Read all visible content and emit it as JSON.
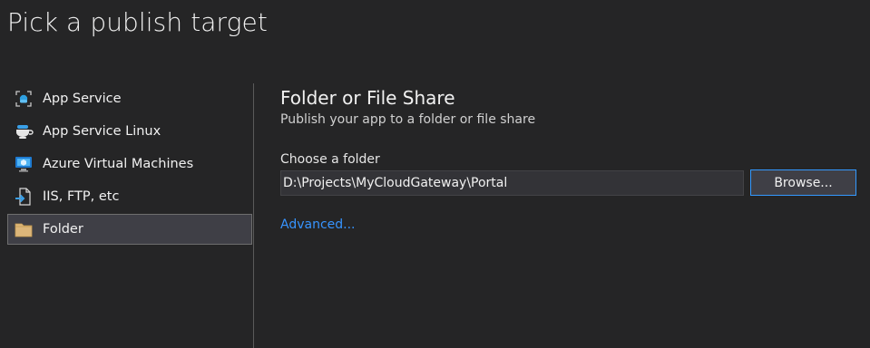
{
  "page": {
    "title": "Pick a publish target"
  },
  "sidebar": {
    "items": [
      {
        "label": "App Service",
        "icon": "app-service-icon"
      },
      {
        "label": "App Service Linux",
        "icon": "app-service-linux-icon"
      },
      {
        "label": "Azure Virtual Machines",
        "icon": "virtual-machine-icon"
      },
      {
        "label": "IIS, FTP, etc",
        "icon": "iis-ftp-icon"
      },
      {
        "label": "Folder",
        "icon": "folder-icon",
        "selected": true
      }
    ]
  },
  "detail": {
    "title": "Folder or File Share",
    "subtitle": "Publish your app to a folder or file share",
    "folder_label": "Choose a folder",
    "folder_value": "D:\\Projects\\MyCloudGateway\\Portal",
    "browse_label": "Browse...",
    "advanced_label": "Advanced..."
  },
  "colors": {
    "background": "#252526",
    "selected_bg": "#3f3f46",
    "accent": "#3399ff",
    "link": "#3794ff"
  }
}
